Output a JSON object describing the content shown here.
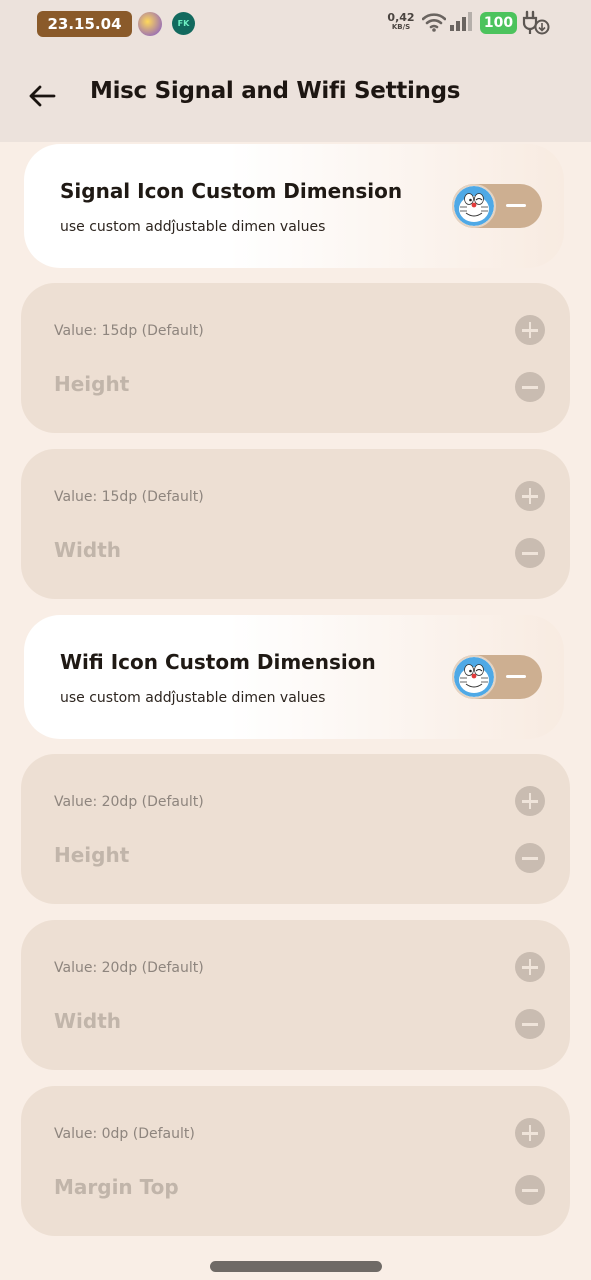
{
  "status_bar": {
    "time": "23.15.04",
    "notification_badge": "FK",
    "net_speed": "0,42",
    "net_speed_unit": "KB/S",
    "battery": "100",
    "colors": {
      "clock_bg": "#8a5a2a",
      "battery_bg": "#4cc35d"
    }
  },
  "header": {
    "title": "Misc Signal and Wifi Settings",
    "back_icon": "arrow-left-icon"
  },
  "signal": {
    "switch": {
      "title": "Signal Icon Custom Dimension",
      "subtitle": "use custom addĵustable dimen values",
      "state": "off"
    },
    "height": {
      "value": "Value: 15dp (Default)",
      "label": "Height"
    },
    "width": {
      "value": "Value: 15dp (Default)",
      "label": "Width"
    }
  },
  "wifi": {
    "switch": {
      "title": "Wifi Icon Custom Dimension",
      "subtitle": "use custom addĵustable dimen values",
      "state": "off"
    },
    "height": {
      "value": "Value: 20dp (Default)",
      "label": "Height"
    },
    "width": {
      "value": "Value: 20dp (Default)",
      "label": "Width"
    },
    "margin_top": {
      "value": "Value: 0dp (Default)",
      "label": "Margin Top"
    }
  },
  "icons": {
    "increment": "plus-icon",
    "decrement": "minus-icon",
    "toggle_thumb": "doraemon-face-icon"
  }
}
